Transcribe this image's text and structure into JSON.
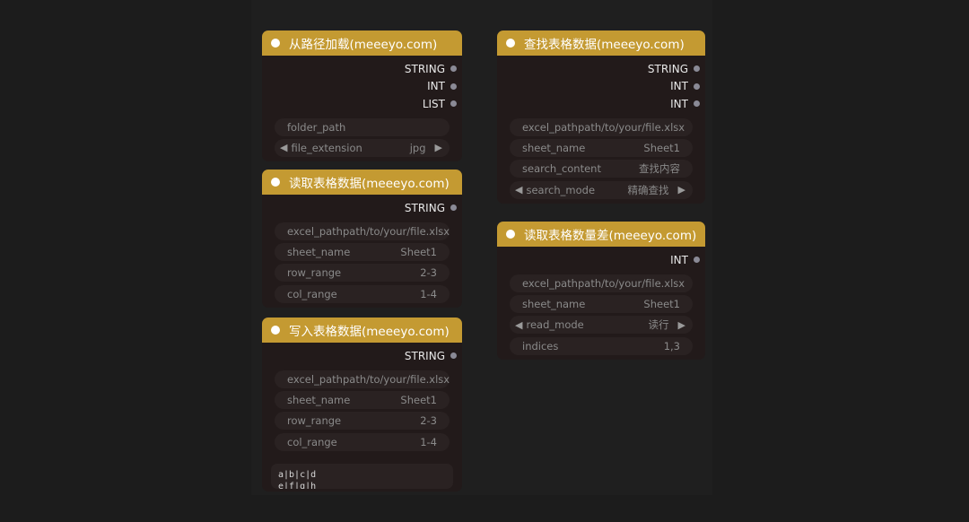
{
  "nodes": {
    "load_path": {
      "title": "从路径加载(meeeyo.com)",
      "outputs": [
        "STRING",
        "INT",
        "LIST"
      ],
      "widgets": {
        "folder_path": {
          "label": "folder_path",
          "value": ""
        },
        "file_extension": {
          "label": "file_extension",
          "value": "jpg",
          "left_arrow": "◀",
          "right_arrow": "▶"
        }
      }
    },
    "read_table": {
      "title": "读取表格数据(meeeyo.com)",
      "outputs": [
        "STRING"
      ],
      "widgets": {
        "excel_path": {
          "label": "excel_path",
          "value": "path/to/your/file.xlsx"
        },
        "sheet_name": {
          "label": "sheet_name",
          "value": "Sheet1"
        },
        "row_range": {
          "label": "row_range",
          "value": "2-3"
        },
        "col_range": {
          "label": "col_range",
          "value": "1-4"
        }
      }
    },
    "write_table": {
      "title": "写入表格数据(meeeyo.com)",
      "outputs": [
        "STRING"
      ],
      "widgets": {
        "excel_path": {
          "label": "excel_path",
          "value": "path/to/your/file.xlsx"
        },
        "sheet_name": {
          "label": "sheet_name",
          "value": "Sheet1"
        },
        "row_range": {
          "label": "row_range",
          "value": "2-3"
        },
        "col_range": {
          "label": "col_range",
          "value": "1-4"
        }
      },
      "textarea": "a|b|c|d\ne|f|g|h"
    },
    "find_table": {
      "title": "查找表格数据(meeeyo.com)",
      "outputs": [
        "STRING",
        "INT",
        "INT"
      ],
      "widgets": {
        "excel_path": {
          "label": "excel_path",
          "value": "path/to/your/file.xlsx"
        },
        "sheet_name": {
          "label": "sheet_name",
          "value": "Sheet1"
        },
        "search_content": {
          "label": "search_content",
          "value": "查找内容"
        },
        "search_mode": {
          "label": "search_mode",
          "value": "精确查找",
          "left_arrow": "◀",
          "right_arrow": "▶"
        }
      }
    },
    "read_diff": {
      "title": "读取表格数量差(meeeyo.com)",
      "outputs": [
        "INT"
      ],
      "widgets": {
        "excel_path": {
          "label": "excel_path",
          "value": "path/to/your/file.xlsx"
        },
        "sheet_name": {
          "label": "sheet_name",
          "value": "Sheet1"
        },
        "read_mode": {
          "label": "read_mode",
          "value": "读行",
          "left_arrow": "◀",
          "right_arrow": "▶"
        },
        "indices": {
          "label": "indices",
          "value": "1,3"
        }
      }
    }
  }
}
